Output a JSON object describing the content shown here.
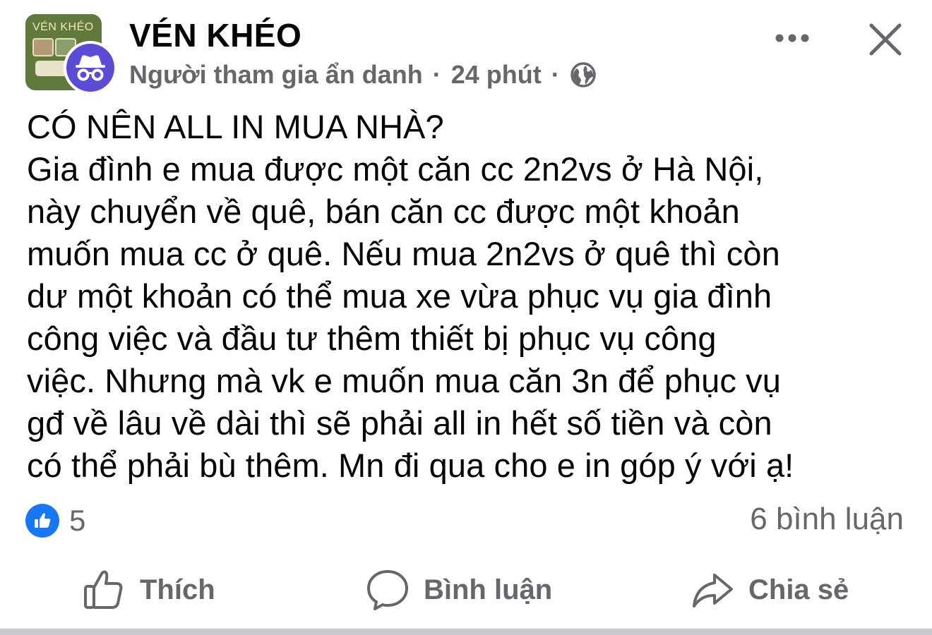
{
  "header": {
    "group_avatar_text": "VÉN KHÉO",
    "group_name": "VÉN KHÉO",
    "author": "Người tham gia ẩn danh",
    "separator": "·",
    "time": "24 phút",
    "privacy_icon": "globe-icon",
    "more_icon": "more-dots-icon",
    "close_icon": "close-icon"
  },
  "post": {
    "lines": [
      "CÓ NÊN ALL IN MUA NHÀ?",
      "Gia đình e mua được một căn cc 2n2vs ở Hà Nội,",
      "này chuyển về quê, bán căn cc được một khoản",
      "muốn mua cc ở quê. Nếu mua 2n2vs ở quê thì còn",
      "dư một khoản có thể mua xe vừa phục vụ gia đình",
      "công việc và đầu tư thêm thiết bị phục vụ công",
      "việc. Nhưng mà vk e muốn mua căn 3n để phục vụ",
      "gđ về lâu về dài thì sẽ phải all in hết số tiền và còn",
      "có thể phải bù thêm. Mn đi qua cho e in góp ý với ạ!"
    ]
  },
  "stats": {
    "reaction_icon": "like-reaction-icon",
    "reaction_count": "5",
    "comment_count": "6 bình luận"
  },
  "actions": {
    "like_label": "Thích",
    "comment_label": "Bình luận",
    "share_label": "Chia sẻ"
  },
  "colors": {
    "text_primary": "#050505",
    "text_secondary": "#65676b",
    "like_blue": "#1877f2",
    "anon_purple": "#5b4bd6",
    "group_green": "#5f7a3a"
  }
}
